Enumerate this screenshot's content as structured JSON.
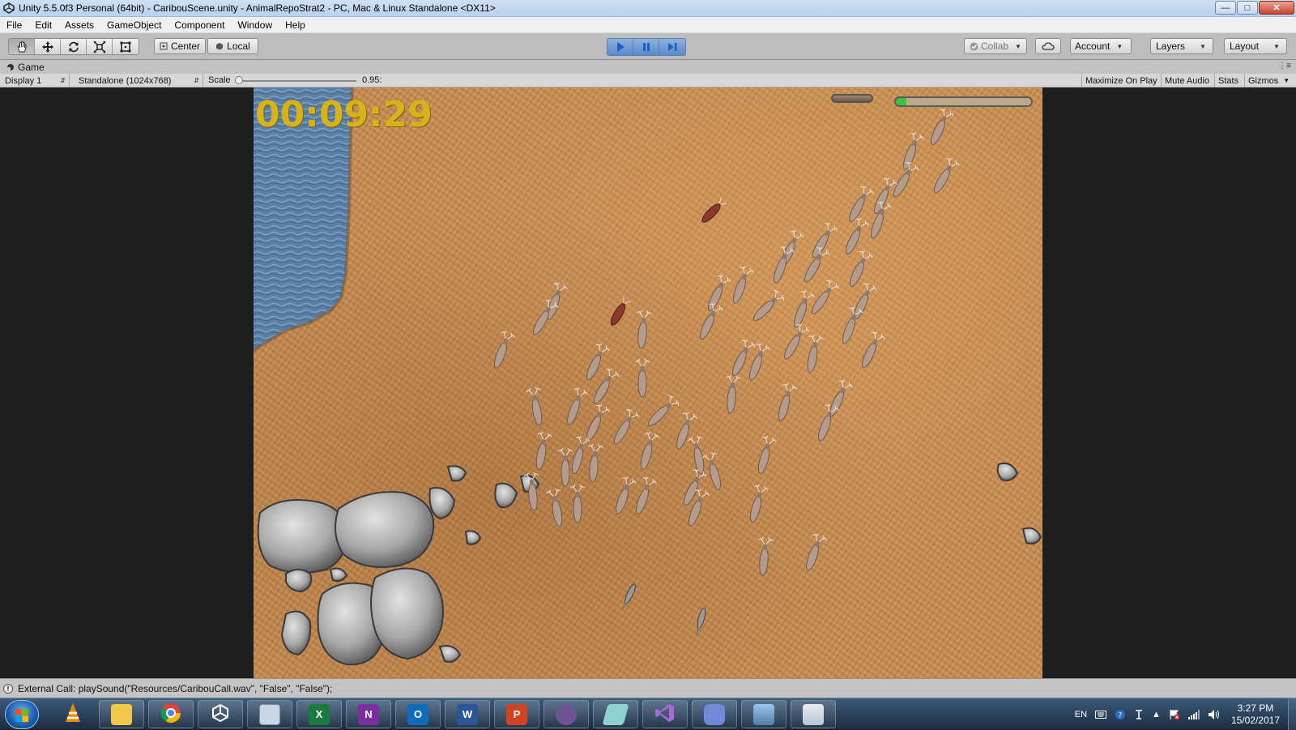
{
  "window": {
    "title": "Unity 5.5.0f3 Personal (64bit) - CaribouScene.unity - AnimalRepoStrat2 - PC, Mac & Linux Standalone <DX11>",
    "minimize": "—",
    "maximize": "□",
    "close": "✕"
  },
  "menu": [
    "File",
    "Edit",
    "Assets",
    "GameObject",
    "Component",
    "Window",
    "Help"
  ],
  "toolbar": {
    "tools": [
      "hand-tool",
      "move-tool",
      "rotate-tool",
      "scale-tool",
      "rect-tool"
    ],
    "pivot_label": "Center",
    "space_label": "Local",
    "collab_label": "Collab",
    "account_label": "Account",
    "layers_label": "Layers",
    "layout_label": "Layout"
  },
  "game_view": {
    "tab_label": "Game",
    "display": "Display 1",
    "resolution": "Standalone (1024x768)",
    "scale_label": "Scale",
    "scale_value": "0.95:",
    "maximize_on_play": "Maximize On Play",
    "mute_audio": "Mute Audio",
    "stats": "Stats",
    "gizmos": "Gizmos"
  },
  "game": {
    "timer": "00:09:29",
    "progress": 0.08,
    "colors": {
      "timer": "#d8b21a",
      "progress": "#3cc33c",
      "ground": "#c48a52",
      "water": "#5a7fa6"
    }
  },
  "status": {
    "message": "External Call: playSound(\"Resources/CaribouCall.wav\", \"False\", \"False\");"
  },
  "taskbar": {
    "apps": [
      "vlc-icon",
      "file-explorer-icon",
      "chrome-icon",
      "unity-icon",
      "calculator-icon",
      "excel-icon",
      "onenote-icon",
      "outlook-icon",
      "word-icon",
      "powerpoint-icon",
      "github-desktop-icon",
      "notes-icon",
      "visual-studio-icon",
      "discord-icon",
      "photos-icon",
      "paint-icon"
    ],
    "language": "EN",
    "time": "3:27 PM",
    "date": "15/02/2017"
  }
}
